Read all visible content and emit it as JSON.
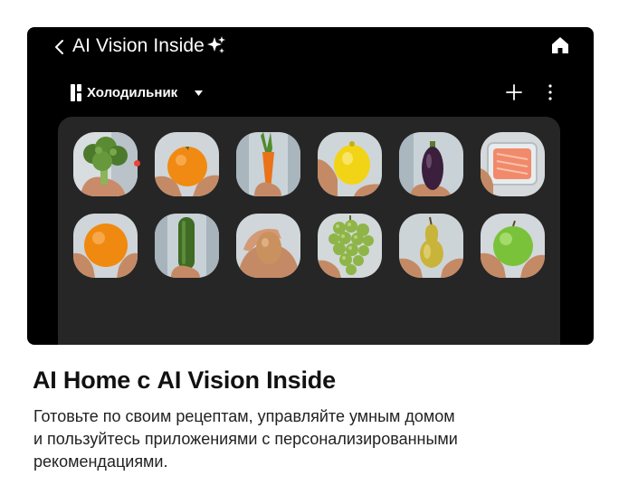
{
  "app": {
    "title": "AI Vision Inside",
    "icons": [
      "back-chevron-icon",
      "sparkle-icon",
      "home-icon"
    ]
  },
  "device_bar": {
    "device_name": "Холодильник",
    "icons": [
      "fridge-icon",
      "dropdown-caret-icon",
      "add-icon",
      "more-options-icon"
    ]
  },
  "food_items": [
    {
      "name": "broccoli",
      "new": true
    },
    {
      "name": "orange"
    },
    {
      "name": "carrot"
    },
    {
      "name": "lemon"
    },
    {
      "name": "eggplant"
    },
    {
      "name": "salmon-fillet"
    },
    {
      "name": "orange"
    },
    {
      "name": "cucumber"
    },
    {
      "name": "egg"
    },
    {
      "name": "grapes"
    },
    {
      "name": "pear"
    },
    {
      "name": "green-apple"
    }
  ],
  "colors": {
    "screen_bg": "#000000",
    "panel_bg": "#262626",
    "new_indicator": "#e84537",
    "text_white": "#ffffff"
  },
  "caption": {
    "headline": "AI Home с AI Vision Inside",
    "description_lines": [
      "Готовьте по своим рецептам, управляйте умным домом",
      "и пользуйтесь приложениями с персонализированными",
      "рекомендациями."
    ]
  }
}
